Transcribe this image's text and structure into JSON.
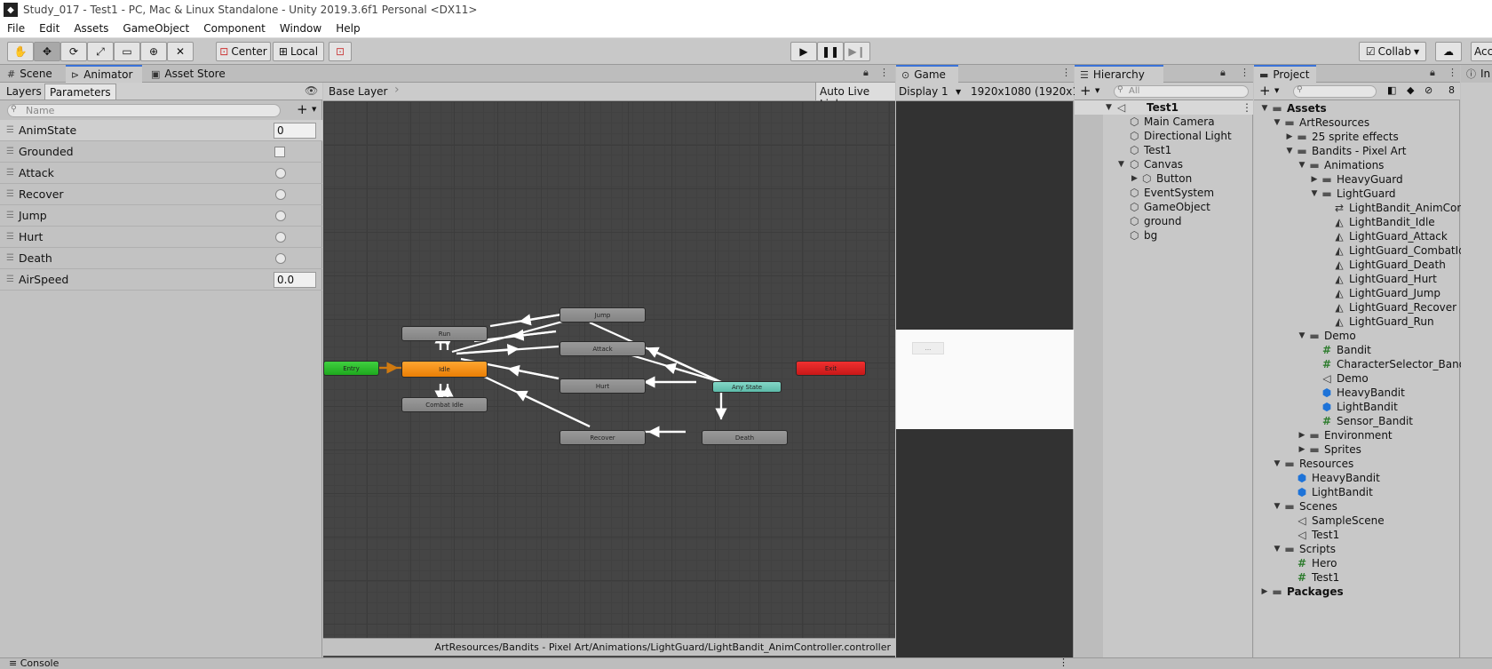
{
  "window": {
    "title": "Study_017 - Test1 - PC, Mac & Linux Standalone - Unity 2019.3.6f1 Personal <DX11>"
  },
  "menu": [
    "File",
    "Edit",
    "Assets",
    "GameObject",
    "Component",
    "Window",
    "Help"
  ],
  "toolbar": {
    "pivot_label": "Center",
    "space_label": "Local",
    "collab_label": "Collab",
    "account_label": "Acc"
  },
  "tabs": {
    "scene": "Scene",
    "animator": "Animator",
    "asset_store": "Asset Store",
    "game": "Game",
    "hierarchy": "Hierarchy",
    "project": "Project",
    "inspector": "In",
    "console": "Console"
  },
  "animator": {
    "layers_tab": "Layers",
    "parameters_tab": "Parameters",
    "search_placeholder": "Name",
    "breadcrumb": "Base Layer",
    "auto_live_link": "Auto Live Link",
    "footer_path": "ArtResources/Bandits - Pixel Art/Animations/LightGuard/LightBandit_AnimController.controller",
    "parameters": [
      {
        "name": "AnimState",
        "type": "int",
        "value": "0"
      },
      {
        "name": "Grounded",
        "type": "bool"
      },
      {
        "name": "Attack",
        "type": "trigger"
      },
      {
        "name": "Recover",
        "type": "trigger"
      },
      {
        "name": "Jump",
        "type": "trigger"
      },
      {
        "name": "Hurt",
        "type": "trigger"
      },
      {
        "name": "Death",
        "type": "trigger"
      },
      {
        "name": "AirSpeed",
        "type": "float",
        "value": "0.0"
      }
    ],
    "states": {
      "entry": "Entry",
      "idle": "Idle",
      "run": "Run",
      "combat_idle": "Combat Idle",
      "jump": "Jump",
      "attack": "Attack",
      "hurt": "Hurt",
      "recover": "Recover",
      "any_state": "Any State",
      "death": "Death",
      "exit": "Exit"
    },
    "colors": {
      "entry": "#2ab82a",
      "default": "#f08a10",
      "any": "#6cc8b8",
      "exit": "#d81e1e"
    }
  },
  "game": {
    "display": "Display 1",
    "resolution": "1920x1080 (1920x10",
    "button_text": "..."
  },
  "hierarchy": {
    "search_placeholder": "All",
    "scene": "Test1",
    "items": [
      "Main Camera",
      "Directional Light",
      "Test1",
      "Canvas",
      "Button",
      "EventSystem",
      "GameObject",
      "ground",
      "bg"
    ]
  },
  "project": {
    "hidden_count": "8",
    "tree": [
      "Assets",
      "ArtResources",
      "25 sprite effects",
      "Bandits - Pixel Art",
      "Animations",
      "HeavyGuard",
      "LightGuard",
      "LightBandit_AnimCont",
      "LightBandit_Idle",
      "LightGuard_Attack",
      "LightGuard_CombatIdl",
      "LightGuard_Death",
      "LightGuard_Hurt",
      "LightGuard_Jump",
      "LightGuard_Recover",
      "LightGuard_Run",
      "Demo",
      "Bandit",
      "CharacterSelector_Bandi",
      "Demo",
      "HeavyBandit",
      "LightBandit",
      "Sensor_Bandit",
      "Environment",
      "Sprites",
      "Resources",
      "HeavyBandit",
      "LightBandit",
      "Scenes",
      "SampleScene",
      "Test1",
      "Scripts",
      "Hero",
      "Test1",
      "Packages"
    ]
  }
}
